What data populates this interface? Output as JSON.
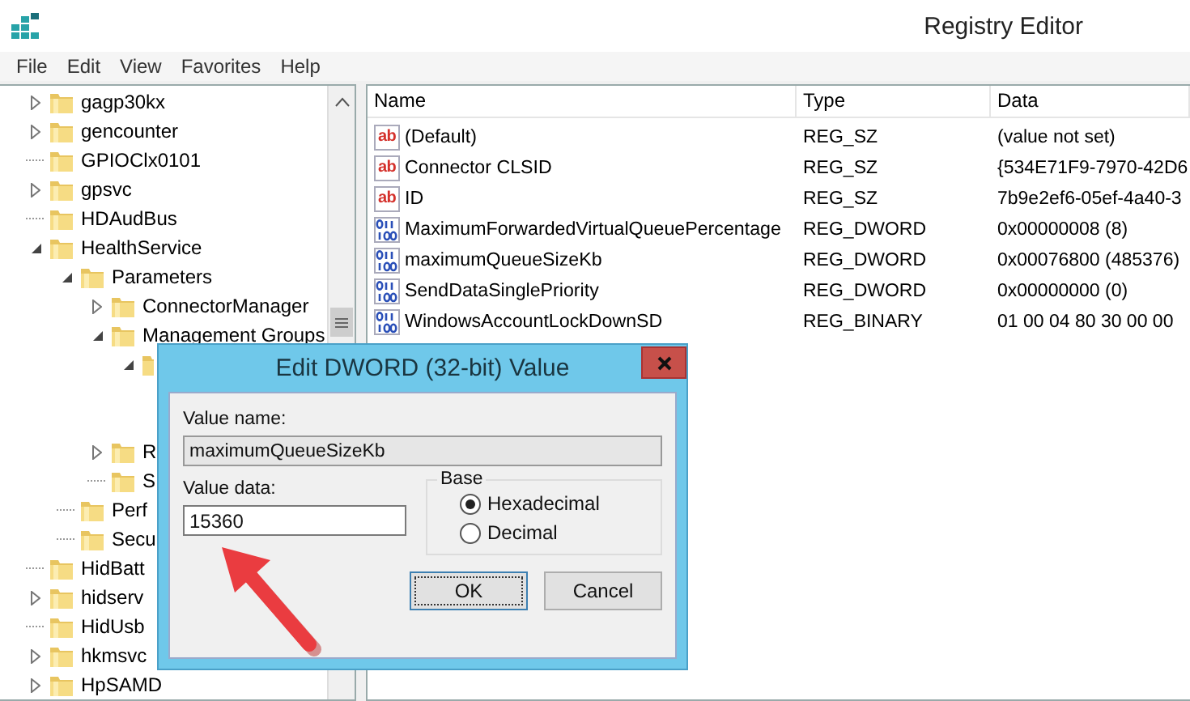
{
  "window": {
    "title": "Registry Editor"
  },
  "menu": [
    "File",
    "Edit",
    "View",
    "Favorites",
    "Help"
  ],
  "tree": [
    {
      "label": "gagp30kx",
      "expanded": false
    },
    {
      "label": "gencounter",
      "expanded": false
    },
    {
      "label": "GPIOClx0101"
    },
    {
      "label": "gpsvc",
      "expanded": false
    },
    {
      "label": "HDAudBus"
    },
    {
      "label": "HealthService",
      "expanded": true,
      "children": [
        {
          "label": "Parameters",
          "expanded": true,
          "children": [
            {
              "label": "ConnectorManager",
              "expanded": false
            },
            {
              "label": "Management Groups",
              "expanded": true,
              "children": [
                {
                  "expanded": true
                }
              ]
            },
            {
              "label": "R",
              "expanded": false
            },
            {
              "label": "S"
            }
          ]
        },
        {
          "label": "Perf"
        },
        {
          "label": "Secu"
        }
      ]
    },
    {
      "label": "HidBatt"
    },
    {
      "label": "hidserv",
      "expanded": false
    },
    {
      "label": "HidUsb"
    },
    {
      "label": "hkmsvc",
      "expanded": false
    },
    {
      "label": "HpSAMD",
      "expanded": false
    }
  ],
  "values": {
    "columns": [
      "Name",
      "Type",
      "Data"
    ],
    "rows": [
      {
        "kind": "string",
        "icon_text": "ab",
        "name": "(Default)",
        "type": "REG_SZ",
        "data": "(value not set)"
      },
      {
        "kind": "string",
        "icon_text": "ab",
        "name": "Connector CLSID",
        "type": "REG_SZ",
        "data": "{534E71F9-7970-42D6"
      },
      {
        "kind": "string",
        "icon_text": "ab",
        "name": "ID",
        "type": "REG_SZ",
        "data": "7b9e2ef6-05ef-4a40-3"
      },
      {
        "kind": "binary",
        "name": "MaximumForwardedVirtualQueuePercentage",
        "type": "REG_DWORD",
        "data": "0x00000008 (8)"
      },
      {
        "kind": "binary",
        "name": "maximumQueueSizeKb",
        "type": "REG_DWORD",
        "data": "0x00076800 (485376)"
      },
      {
        "kind": "binary",
        "name": "SendDataSinglePriority",
        "type": "REG_DWORD",
        "data": "0x00000000 (0)"
      },
      {
        "kind": "binary",
        "name": "WindowsAccountLockDownSD",
        "type": "REG_BINARY",
        "data": "01 00 04 80 30 00 00"
      }
    ]
  },
  "dialog": {
    "title": "Edit DWORD (32-bit) Value",
    "value_name_label": "Value name:",
    "value_name": "maximumQueueSizeKb",
    "value_data_label": "Value data:",
    "value_data": "15360",
    "base": {
      "label": "Base",
      "options": [
        {
          "label": "Hexadecimal",
          "selected": true
        },
        {
          "label": "Decimal",
          "selected": false
        }
      ]
    },
    "buttons": [
      {
        "label": "OK",
        "focused": true
      },
      {
        "label": "Cancel",
        "focused": false
      }
    ]
  }
}
